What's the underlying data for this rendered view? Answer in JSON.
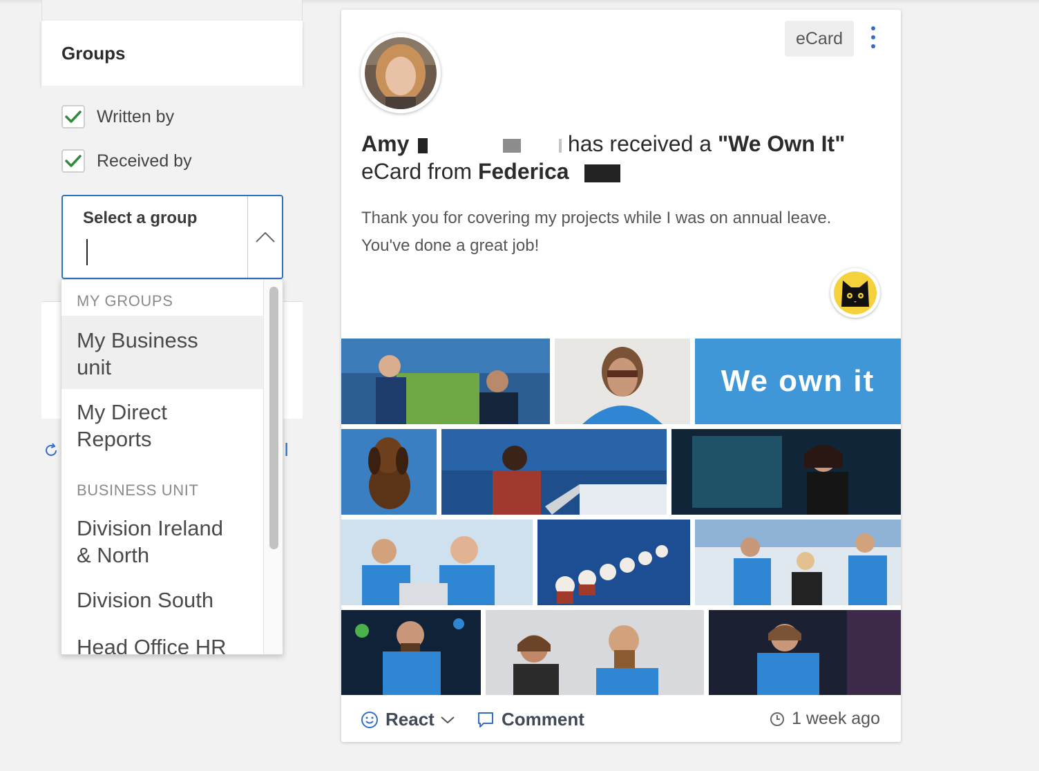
{
  "filters": {
    "title": "Groups",
    "written_by": "Written by",
    "received_by": "Received by",
    "select_label": "Select a group",
    "link_fragment": "il"
  },
  "dropdown": {
    "my_groups_header": "MY GROUPS",
    "business_unit_header": "BUSINESS UNIT",
    "items": [
      {
        "line1": "My Business",
        "line2": "unit"
      },
      {
        "line1": "My Direct",
        "line2": "Reports"
      },
      {
        "line1": "Division Ireland",
        "line2": "& North"
      },
      {
        "line1": "Division South",
        "line2": ""
      },
      {
        "line1": "Head Office HR",
        "line2": ""
      }
    ]
  },
  "post": {
    "badge": "eCard",
    "recipient_first": "Amy",
    "text_received": "has received a",
    "card_name": "\"We Own It\"",
    "text_from": "eCard from",
    "sender_first": "Federica",
    "message_line1": "Thank you for covering my projects while I was on annual leave.",
    "message_line2": "You've done a great job!",
    "banner_text": "We own it"
  },
  "footer": {
    "react": "React",
    "comment": "Comment",
    "time": "1 week ago"
  },
  "colors": {
    "accent": "#2f6fc7",
    "check_green": "#2e8b3d",
    "banner_blue": "#3f97d8",
    "page_bg": "#f2f2f2"
  },
  "icons": [
    "check-icon",
    "chevron-up-icon",
    "refresh-icon",
    "more-vertical-icon",
    "cat-icon",
    "smile-icon",
    "chevron-down-icon",
    "comment-icon",
    "clock-icon"
  ]
}
